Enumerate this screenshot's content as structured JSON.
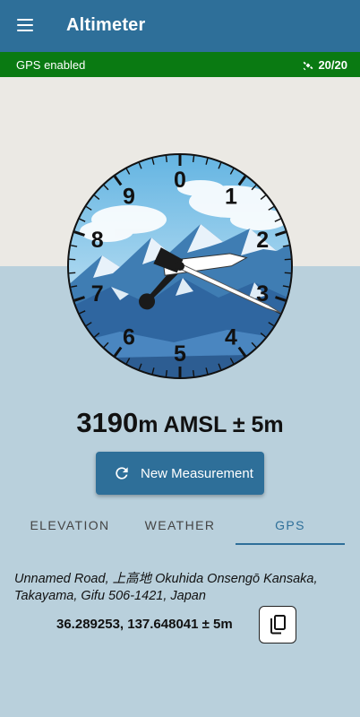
{
  "app": {
    "title": "Altimeter"
  },
  "gps_bar": {
    "status": "GPS enabled",
    "satellites": "20/20",
    "color": "#0a7a12"
  },
  "dial": {
    "numerals": [
      "0",
      "1",
      "2",
      "3",
      "4",
      "5",
      "6",
      "7",
      "8",
      "9"
    ],
    "hands": {
      "large_hand_value": 3.19,
      "medium_hand_value": 2.3,
      "short_hand_value": 6.2
    }
  },
  "altitude": {
    "value": "3190",
    "unit_label": "m AMSL ± 5m"
  },
  "actions": {
    "new_measurement": "New Measurement"
  },
  "tabs": [
    {
      "label": "ELEVATION",
      "active": false
    },
    {
      "label": "WEATHER",
      "active": false
    },
    {
      "label": "GPS",
      "active": true
    }
  ],
  "gps": {
    "address": "Unnamed Road, 上高地 Okuhida Onsengō Kansaka, Takayama, Gifu 506-1421, Japan",
    "coordinates": "36.289253, 137.648041 ± 5m"
  },
  "colors": {
    "primary": "#2e6f99",
    "background": "#b9d0dc"
  }
}
